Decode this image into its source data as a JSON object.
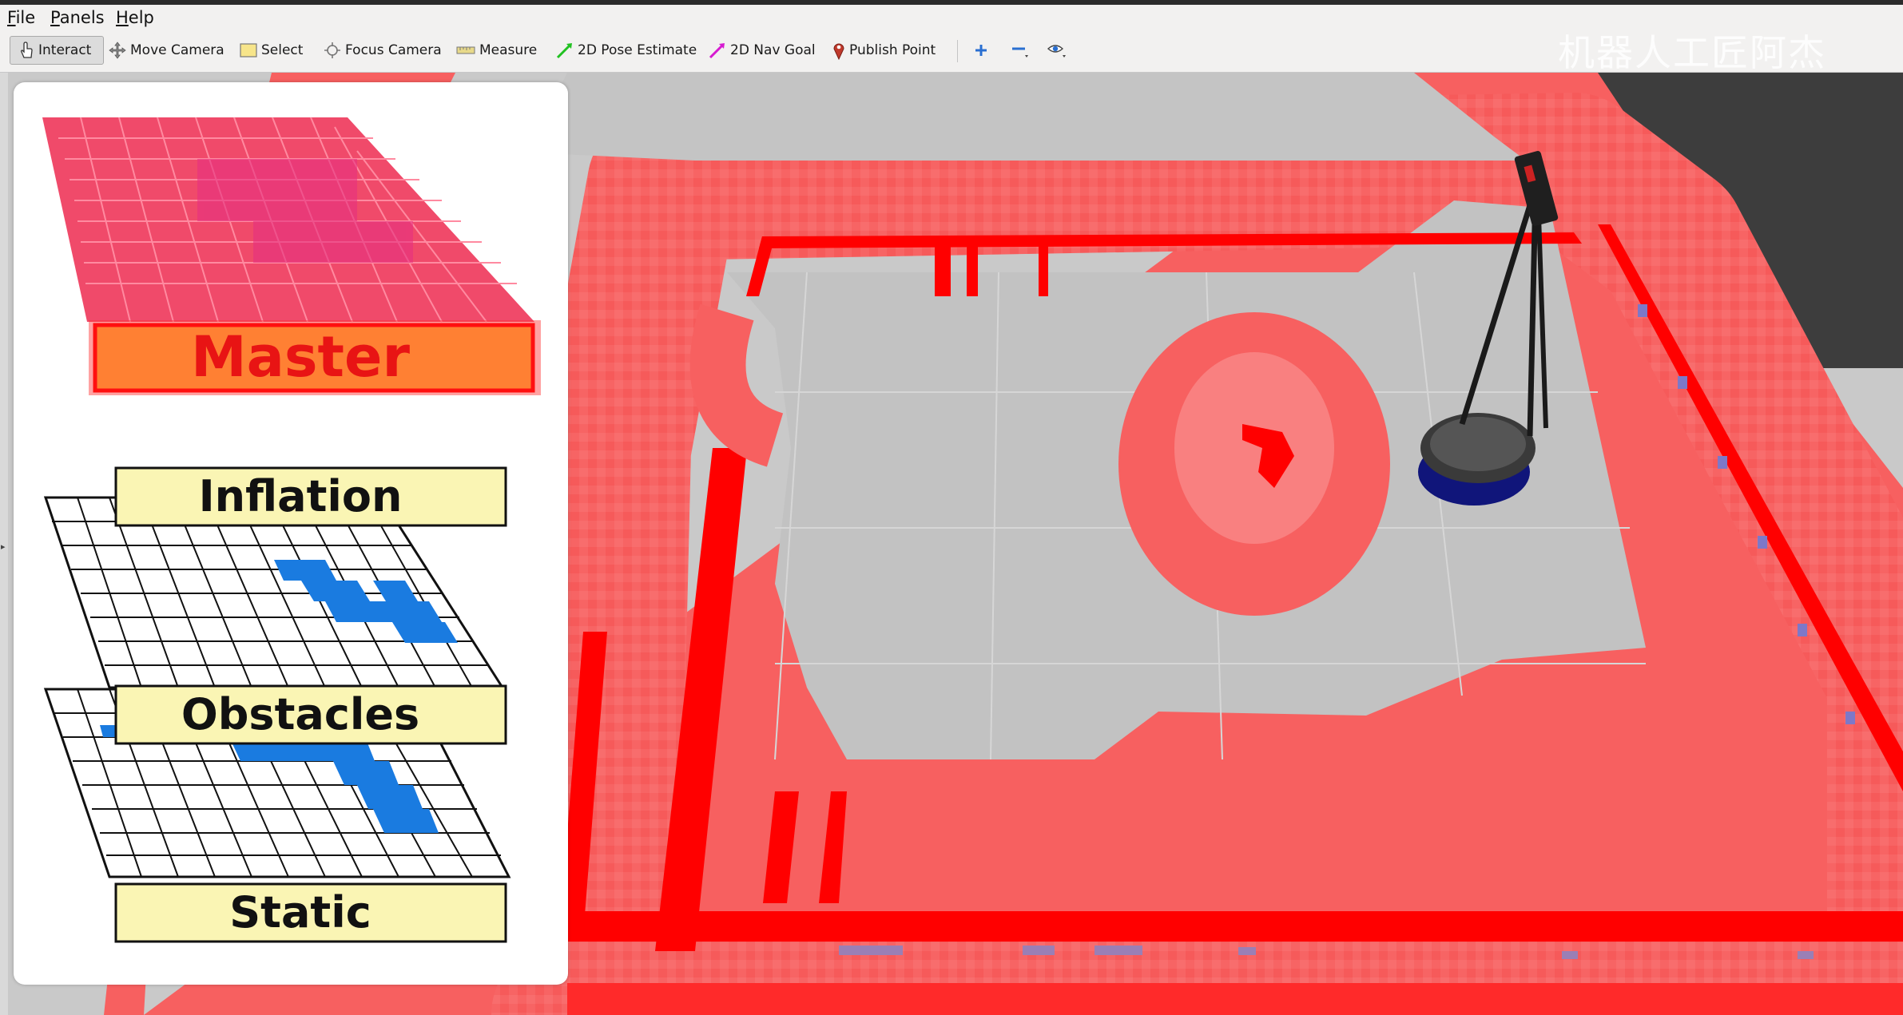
{
  "menu": {
    "items": [
      {
        "mnemonic": "F",
        "rest": "ile"
      },
      {
        "mnemonic": "P",
        "rest": "anels"
      },
      {
        "mnemonic": "H",
        "rest": "elp"
      }
    ]
  },
  "toolbar": {
    "interact": "Interact",
    "move_camera": "Move Camera",
    "select": "Select",
    "focus_camera": "Focus Camera",
    "measure": "Measure",
    "pose_estimate": "2D Pose Estimate",
    "nav_goal": "2D Nav Goal",
    "publish_point": "Publish Point"
  },
  "watermark": "机器人工匠阿杰",
  "layers": {
    "master": "Master",
    "inflation": "Inflation",
    "obstacles": "Obstacles",
    "static": "Static"
  },
  "colors": {
    "lethal": "#ff0000",
    "inflated": "#f76060",
    "free": "#c2c2c2",
    "background": "#3b3b3b",
    "obstacle_cell": "#1a7be0",
    "label_fill": "#faf5b4",
    "master_label_fill": "#ff8033"
  }
}
